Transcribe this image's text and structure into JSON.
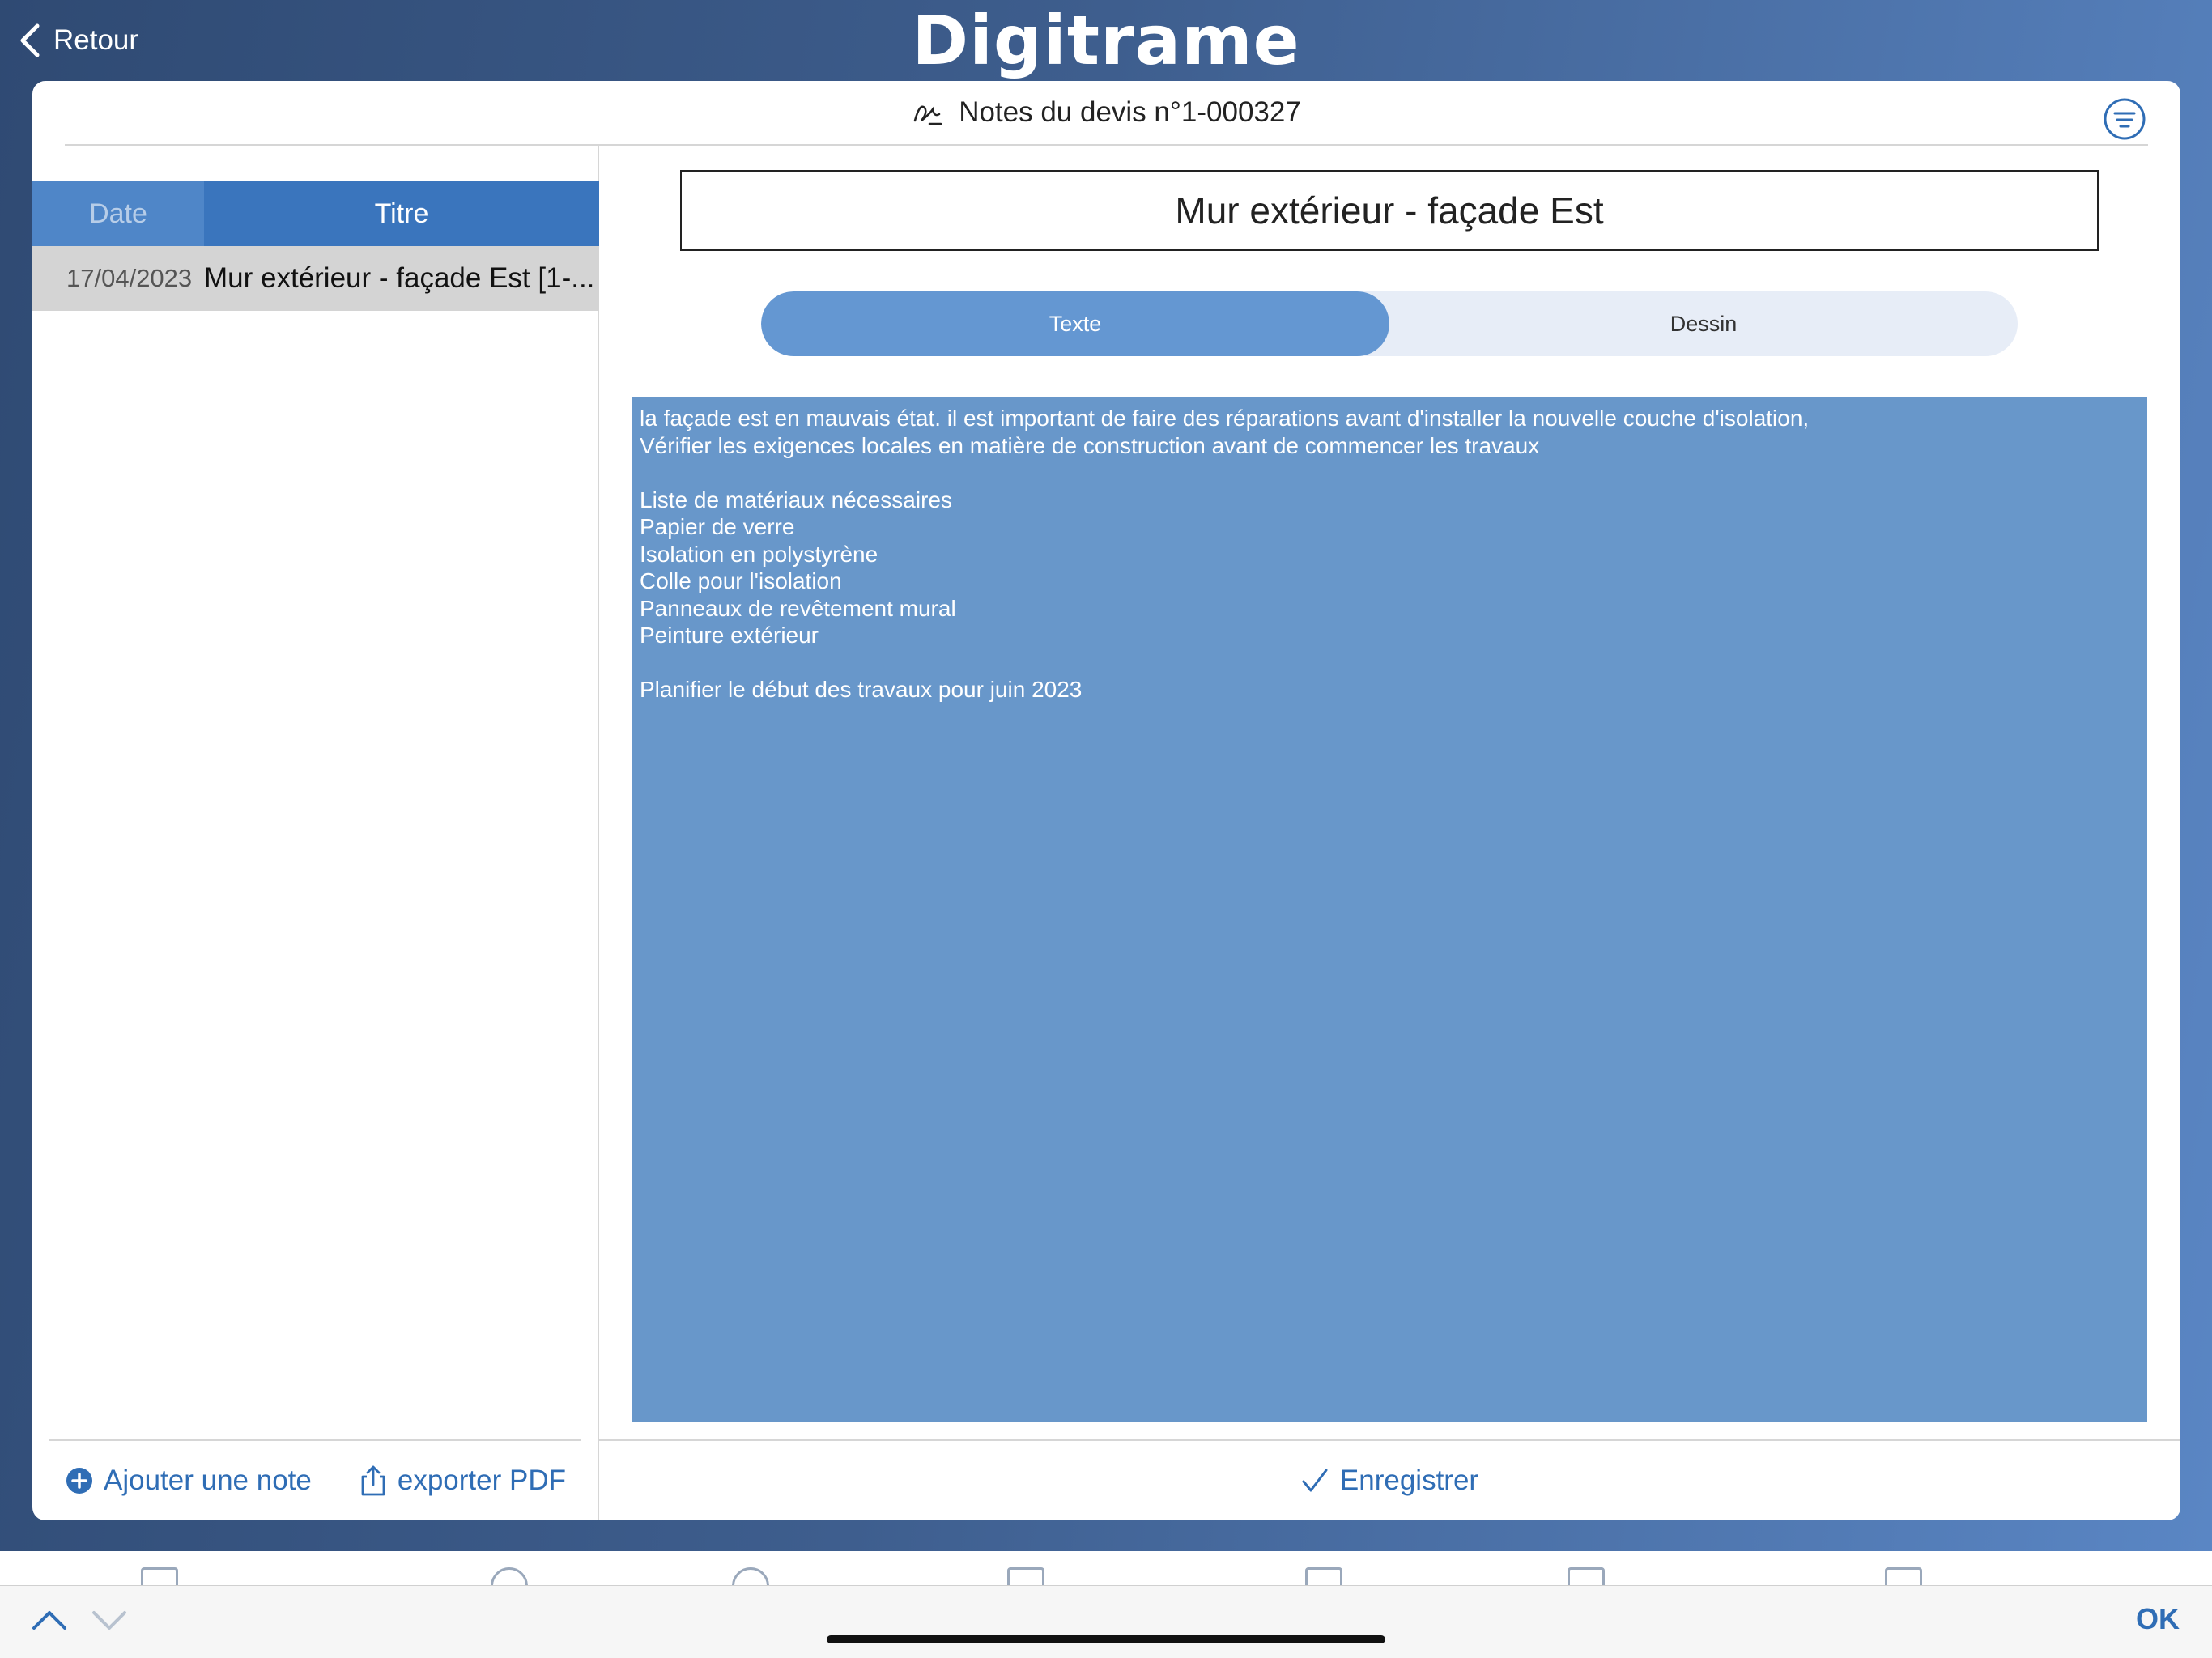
{
  "header": {
    "back_label": "Retour",
    "logo": "Digitrame"
  },
  "card": {
    "title": "Notes du devis n°1-000327"
  },
  "notes_list": {
    "columns": {
      "date": "Date",
      "title": "Titre"
    },
    "rows": [
      {
        "date": "17/04/2023",
        "title": "Mur extérieur - façade Est [1-..."
      }
    ],
    "add_label": "Ajouter une note",
    "export_label": "exporter PDF"
  },
  "editor": {
    "note_title": "Mur extérieur - façade Est",
    "tabs": {
      "text": "Texte",
      "drawing": "Dessin",
      "active": "Texte"
    },
    "content": "la façade est en mauvais état. il est important de faire des réparations avant d'installer la nouvelle couche d'isolation,\nVérifier les exigences locales en matière de construction avant de commencer les travaux\n\nListe de matériaux nécessaires\nPapier de verre\nIsolation en polystyrène\nColle pour l'isolation\nPanneaux de revêtement mural\nPeinture extérieur\n\nPlanifier le début des travaux pour juin 2023",
    "save_label": "Enregistrer"
  },
  "keyboard_accessory": {
    "ok_label": "OK"
  },
  "colors": {
    "accent": "#2f6db5",
    "editor_bg": "#6897ca",
    "segment_active": "#6497d2",
    "list_header": "#3a75bd"
  }
}
